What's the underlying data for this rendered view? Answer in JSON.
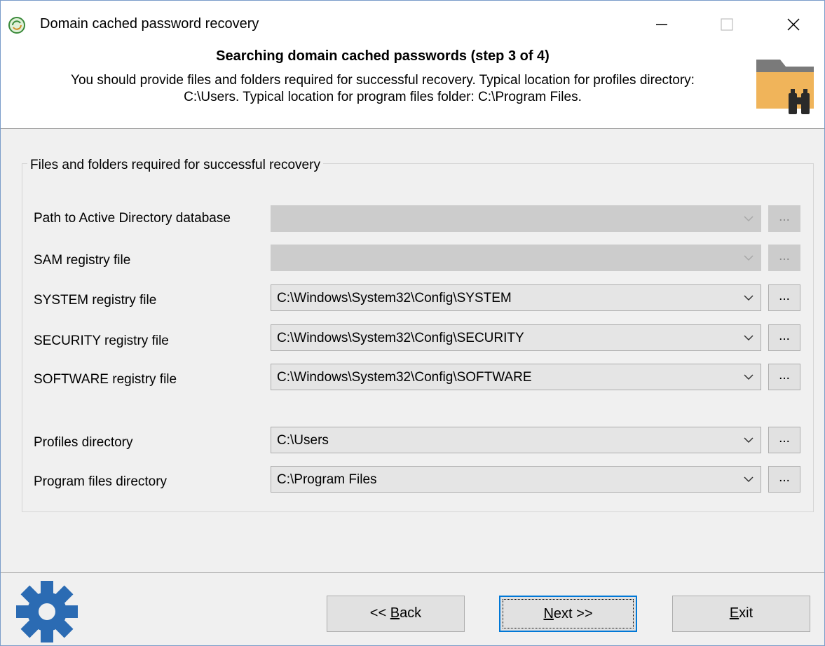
{
  "window": {
    "title": "Domain cached password recovery"
  },
  "header": {
    "title": "Searching domain cached passwords (step 3 of 4)",
    "description_line1": "You should provide files and folders required for successful recovery. Typical location for profiles directory:",
    "description_line2": "C:\\Users. Typical location for program files folder: C:\\Program Files.",
    "icon": "folder-binoculars-icon"
  },
  "group": {
    "title": "Files and folders required for successful recovery",
    "fields": [
      {
        "label": "Path to Active Directory database",
        "value": "",
        "enabled": false,
        "browse": "..."
      },
      {
        "label": "SAM registry file",
        "value": "",
        "enabled": false,
        "browse": "..."
      },
      {
        "label": "SYSTEM registry file",
        "value": "C:\\Windows\\System32\\Config\\SYSTEM",
        "enabled": true,
        "browse": "..."
      },
      {
        "label": "SECURITY registry file",
        "value": "C:\\Windows\\System32\\Config\\SECURITY",
        "enabled": true,
        "browse": "..."
      },
      {
        "label": "SOFTWARE registry file",
        "value": "C:\\Windows\\System32\\Config\\SOFTWARE",
        "enabled": true,
        "browse": "..."
      },
      {
        "label": "Profiles directory",
        "value": "C:\\Users",
        "enabled": true,
        "browse": "..."
      },
      {
        "label": "Program files directory",
        "value": "C:\\Program Files",
        "enabled": true,
        "browse": "..."
      }
    ]
  },
  "buttons": {
    "back": {
      "prefix": "<< ",
      "mnemonic": "B",
      "rest": "ack"
    },
    "next": {
      "mnemonic": "N",
      "rest": "ext >>"
    },
    "exit": {
      "mnemonic": "E",
      "rest": "xit"
    }
  },
  "colors": {
    "accent": "#0078d7",
    "folder": "#f0b45a",
    "gear": "#2b6bb3"
  }
}
